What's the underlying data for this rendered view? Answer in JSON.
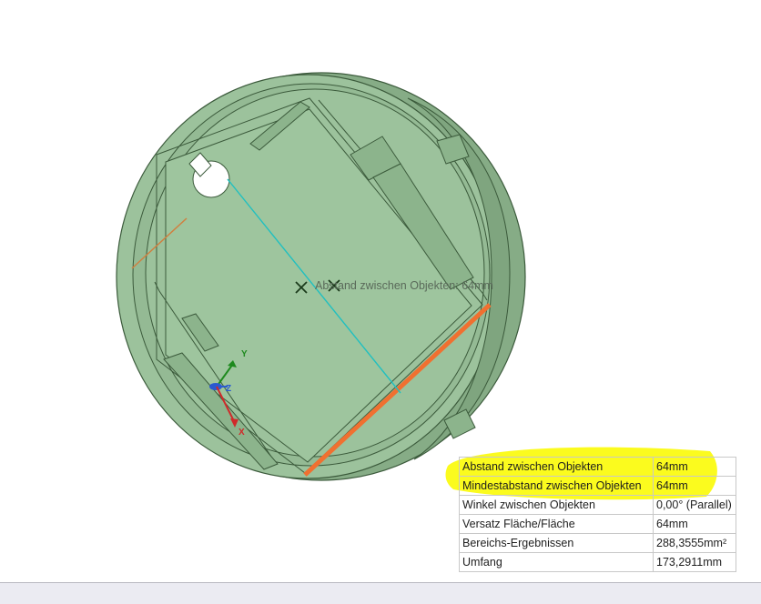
{
  "viewport": {
    "dimension_label": "Abstand zwischen Objekten: 64mm",
    "triad": {
      "y_label": "Y",
      "z_label": "Z",
      "x_label": "X"
    }
  },
  "results": {
    "rows": [
      {
        "label": "Abstand zwischen Objekten",
        "value": "64mm",
        "highlighted": true
      },
      {
        "label": "Mindestabstand zwischen Objekten",
        "value": "64mm",
        "highlighted": true
      },
      {
        "label": "Winkel zwischen Objekten",
        "value": "0,00° (Parallel)",
        "highlighted": false
      },
      {
        "label": "Versatz Fläche/Fläche",
        "value": "64mm",
        "highlighted": false
      },
      {
        "label": "Bereichs-Ergebnissen",
        "value": "288,3555mm²",
        "highlighted": false
      },
      {
        "label": "Umfang",
        "value": "173,2911mm",
        "highlighted": false
      }
    ]
  },
  "colors": {
    "part_fill": "#9cc29c",
    "part_edge": "#3b5a3b",
    "part_wall": "#86ac86",
    "measure_line": "#20c0c0",
    "selected_face": "#f07030",
    "highlight": "#fbfb1e"
  }
}
